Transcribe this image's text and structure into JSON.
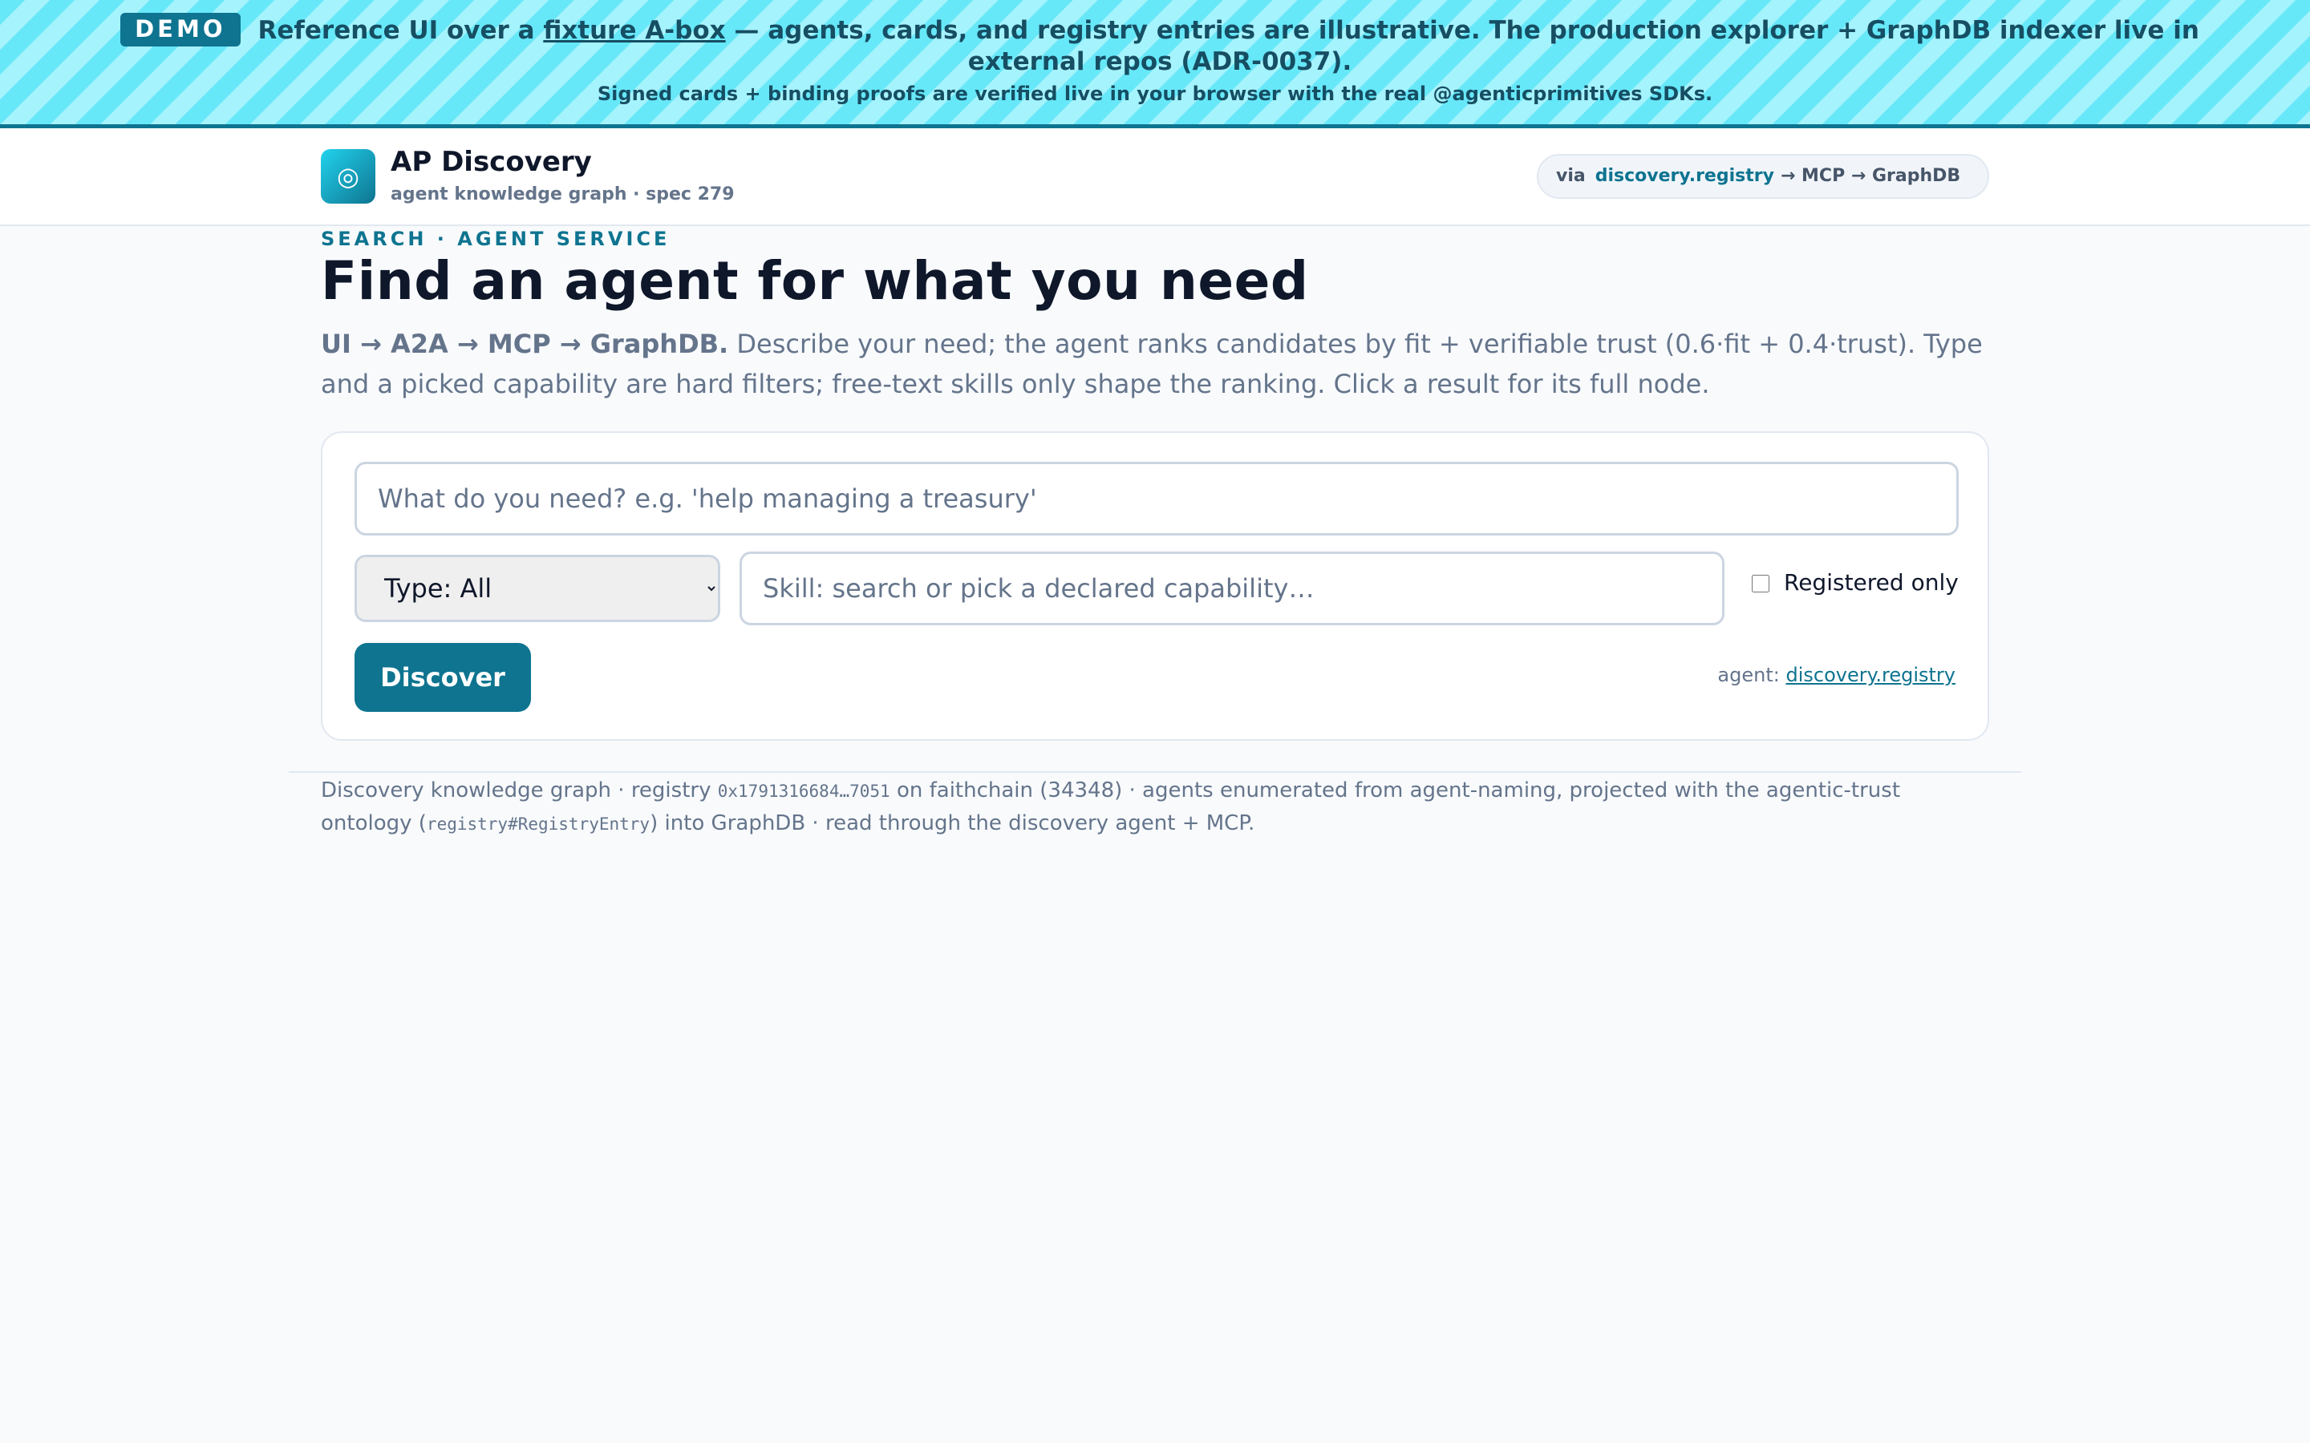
{
  "banner": {
    "badge": "DEMO",
    "line1_before": "Reference UI over a",
    "line1_link": "fixture A-box",
    "line1_after": "— agents, cards, and registry entries are illustrative. The production explorer + GraphDB indexer live in external repos (ADR-0037).",
    "line2": "Signed cards + binding proofs are verified live in your browser with the real @agenticprimitives SDKs."
  },
  "header": {
    "logo_glyph": "◎",
    "title": "AP Discovery",
    "subtitle": "agent knowledge graph · spec 279",
    "via_label": "via",
    "via_agent": "discovery.registry",
    "via_path": "→ MCP → GraphDB"
  },
  "main": {
    "eyebrow": "SEARCH · AGENT SERVICE",
    "title": "Find an agent for what you need",
    "lede_bold": "UI → A2A → MCP → GraphDB.",
    "lede_rest": " Describe your need; the agent ranks candidates by fit + verifiable trust (0.6·fit + 0.4·trust). Type and a picked capability are hard filters; free-text skills only shape the ranking. Click a result for its full node."
  },
  "search": {
    "need_placeholder": "What do you need? e.g. 'help managing a treasury'",
    "type_selected": "Type: All",
    "skill_placeholder": "Skill: search or pick a declared capability…",
    "registered_only_label": "Registered only",
    "registered_only_checked": false,
    "discover_label": "Discover",
    "agent_prefix": "agent:",
    "agent_link": "discovery.registry"
  },
  "footer": {
    "part1": "Discovery knowledge graph · registry ",
    "registry_address": "0x1791316684…7051",
    "part2": " on faithchain (34348) · agents enumerated from agent-naming, projected with the agentic-trust ontology (",
    "ontology_term": "registry#RegistryEntry",
    "part3": ") into GraphDB · read through the discovery agent + MCP."
  }
}
